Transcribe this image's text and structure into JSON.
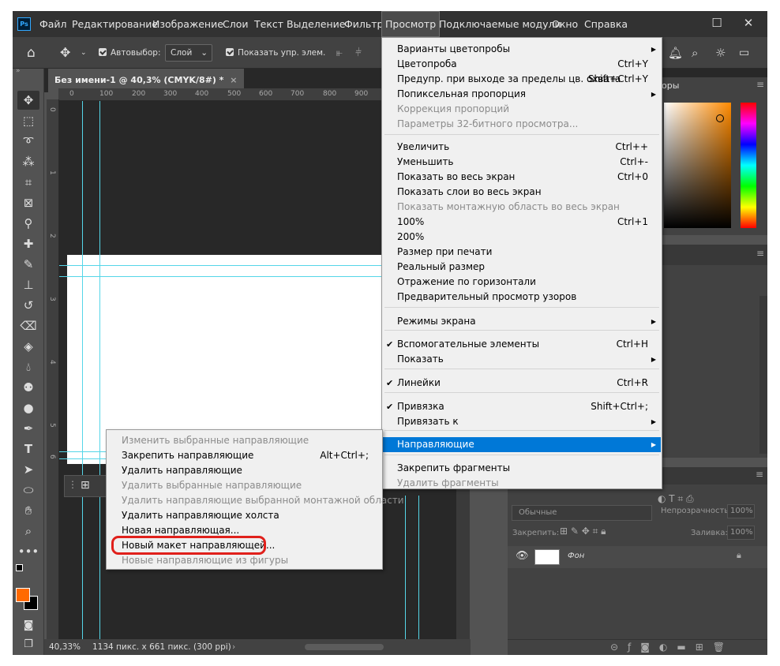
{
  "app": {
    "logo": "Ps",
    "accent": "#31a8ff"
  },
  "menubar": {
    "items": [
      "Файл",
      "Редактирование",
      "Изображение",
      "Слои",
      "Текст",
      "Выделение",
      "Фильтр",
      "Просмотр",
      "Подключаемые модули",
      "Окно",
      "Справка"
    ],
    "active_index": 7
  },
  "window_controls": {
    "minimize": "—",
    "maximize": "☐",
    "close": "✕"
  },
  "options_bar": {
    "autoselect_label": "Автовыбор:",
    "autoselect_value": "Слой",
    "show_transform_label": "Показать упр. элем."
  },
  "document_tab": {
    "title": "Без имени-1 @ 40,3% (CMYK/8#) *",
    "close": "×"
  },
  "ruler": {
    "top_labels": [
      "0",
      "100",
      "200",
      "300",
      "400",
      "500",
      "600",
      "700",
      "800",
      "900"
    ],
    "left_labels": [
      "0",
      "1",
      "2",
      "3",
      "4",
      "5",
      "6"
    ]
  },
  "status_bar": {
    "zoom": "40,33%",
    "doc_info": "1134 пикс. x 661 пикс. (300 ppi)"
  },
  "panels": {
    "color_tab": "оры",
    "layers": {
      "blend_mode": "Обычные",
      "opacity_label": "Непрозрачность:",
      "opacity_value": "100%",
      "lock_label": "Закрепить:",
      "fill_label": "Заливка:",
      "fill_value": "100%",
      "layer_name": "Фон"
    }
  },
  "view_menu": {
    "items": [
      {
        "label": "Варианты цветопробы",
        "shortcut": "",
        "submenu": true,
        "disabled": false
      },
      {
        "label": "Цветопроба",
        "shortcut": "Ctrl+Y",
        "submenu": false,
        "disabled": false
      },
      {
        "label": "Предупр. при выходе за пределы цв. охвата",
        "shortcut": "Shift+Ctrl+Y",
        "submenu": false,
        "disabled": false
      },
      {
        "label": "Попиксельная пропорция",
        "shortcut": "",
        "submenu": true,
        "disabled": false
      },
      {
        "label": "Коррекция пропорций",
        "shortcut": "",
        "submenu": false,
        "disabled": true
      },
      {
        "label": "Параметры 32-битного просмотра...",
        "shortcut": "",
        "submenu": false,
        "disabled": true
      },
      {
        "label": "Увеличить",
        "shortcut": "Ctrl++",
        "submenu": false,
        "disabled": false
      },
      {
        "label": "Уменьшить",
        "shortcut": "Ctrl+-",
        "submenu": false,
        "disabled": false
      },
      {
        "label": "Показать во весь экран",
        "shortcut": "Ctrl+0",
        "submenu": false,
        "disabled": false
      },
      {
        "label": "Показать слои во весь экран",
        "shortcut": "",
        "submenu": false,
        "disabled": false
      },
      {
        "label": "Показать монтажную область во весь экран",
        "shortcut": "",
        "submenu": false,
        "disabled": true
      },
      {
        "label": "100%",
        "shortcut": "Ctrl+1",
        "submenu": false,
        "disabled": false
      },
      {
        "label": "200%",
        "shortcut": "",
        "submenu": false,
        "disabled": false
      },
      {
        "label": "Размер при печати",
        "shortcut": "",
        "submenu": false,
        "disabled": false
      },
      {
        "label": "Реальный размер",
        "shortcut": "",
        "submenu": false,
        "disabled": false
      },
      {
        "label": "Отражение по горизонтали",
        "shortcut": "",
        "submenu": false,
        "disabled": false
      },
      {
        "label": "Предварительный просмотр узоров",
        "shortcut": "",
        "submenu": false,
        "disabled": false
      },
      {
        "label": "Режимы экрана",
        "shortcut": "",
        "submenu": true,
        "disabled": false
      },
      {
        "label": "Вспомогательные элементы",
        "shortcut": "Ctrl+H",
        "submenu": false,
        "disabled": false,
        "checked": true
      },
      {
        "label": "Показать",
        "shortcut": "",
        "submenu": true,
        "disabled": false
      },
      {
        "label": "Линейки",
        "shortcut": "Ctrl+R",
        "submenu": false,
        "disabled": false,
        "checked": true
      },
      {
        "label": "Привязка",
        "shortcut": "Shift+Ctrl+;",
        "submenu": false,
        "disabled": false,
        "checked": true
      },
      {
        "label": "Привязать к",
        "shortcut": "",
        "submenu": true,
        "disabled": false
      },
      {
        "label": "Направляющие",
        "shortcut": "",
        "submenu": true,
        "disabled": false,
        "highlighted": true
      },
      {
        "label": "Закрепить фрагменты",
        "shortcut": "",
        "submenu": false,
        "disabled": false
      },
      {
        "label": "Удалить фрагменты",
        "shortcut": "",
        "submenu": false,
        "disabled": true
      }
    ]
  },
  "guides_submenu": {
    "items": [
      {
        "label": "Изменить выбранные направляющие",
        "shortcut": "",
        "disabled": true
      },
      {
        "label": "Закрепить направляющие",
        "shortcut": "Alt+Ctrl+;",
        "disabled": false
      },
      {
        "label": "Удалить направляющие",
        "shortcut": "",
        "disabled": false
      },
      {
        "label": "Удалить выбранные направляющие",
        "shortcut": "",
        "disabled": true
      },
      {
        "label": "Удалить направляющие выбранной монтажной области",
        "shortcut": "",
        "disabled": true
      },
      {
        "label": "Удалить направляющие холста",
        "shortcut": "",
        "disabled": false
      },
      {
        "label": "Новая направляющая...",
        "shortcut": "",
        "disabled": false
      },
      {
        "label": "Новый макет направляющей...",
        "shortcut": "",
        "disabled": false,
        "circled": true
      },
      {
        "label": "Новые направляющие из фигуры",
        "shortcut": "",
        "disabled": true
      }
    ]
  }
}
